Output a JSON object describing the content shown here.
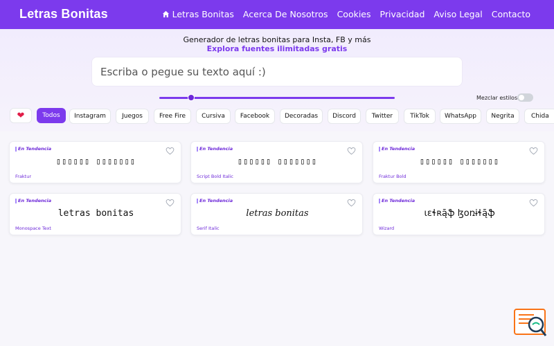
{
  "header": {
    "brand": "Letras Bonitas",
    "nav": [
      "Letras Bonitas",
      "Acerca De Nosotros",
      "Cookies",
      "Privacidad",
      "Aviso Legal",
      "Contacto"
    ],
    "nav_icon": "home-icon"
  },
  "hero": {
    "subtitle": "Generador de letras bonitas para Insta, FB y más",
    "tagline": "Explora fuentes ilimitadas gratis",
    "search_placeholder": "Escriba o pegue su texto aquí :)",
    "mix_label": "Mezclar estilos",
    "mix_enabled": false,
    "slider_level": 0.13
  },
  "chips": [
    "❤",
    "Todos",
    "Instagram",
    "Juegos",
    "Free Fire",
    "Cursiva",
    "Facebook",
    "Decoradas",
    "Discord",
    "Twitter",
    "TikTok",
    "WhatsApp",
    "Negrita",
    "Chida"
  ],
  "active_chip": "Todos",
  "cards": [
    {
      "trend": "En Tendencia",
      "preview": "▯▯▯▯▯▯ ▯▯▯▯▯▯▯",
      "name": "Fraktur"
    },
    {
      "trend": "En Tendencia",
      "preview": "▯▯▯▯▯▯ ▯▯▯▯▯▯▯",
      "name": "Script Bold Italic"
    },
    {
      "trend": "En Tendencia",
      "preview": "▯▯▯▯▯▯ ▯▯▯▯▯▯▯",
      "name": "Fraktur Bold"
    },
    {
      "trend": "En Tendencia",
      "preview": "letras bonitas",
      "name": "Monospace Text"
    },
    {
      "trend": "En Tendencia",
      "preview": "letras bonitas",
      "name": "Serif Italic"
    },
    {
      "trend": "En Tendencia",
      "preview": "ɩɛɬʀą̄ֆ ɮօռɨɬą̄ֆ",
      "name": "Wizard"
    }
  ],
  "colors": {
    "primary": "#7c3aed",
    "heart": "#e11d48",
    "background": "#f7f6fb"
  },
  "icons": [
    "home-icon",
    "heart-icon",
    "favorite-heart-icon",
    "trending-bar-icon",
    "support-badge-icon"
  ]
}
